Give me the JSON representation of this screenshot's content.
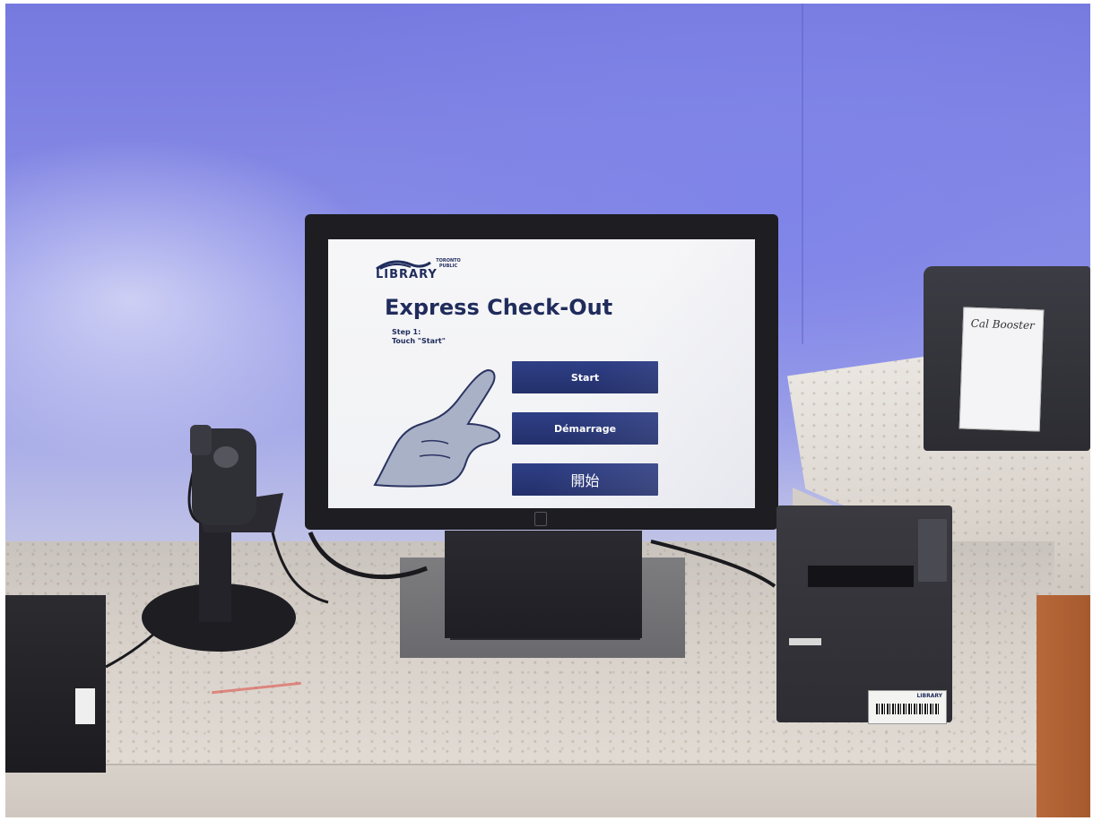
{
  "kiosk": {
    "logo": {
      "small_text_1": "TORONTO",
      "small_text_2": "PUBLIC",
      "main_text": "LIBRARY"
    },
    "title": "Express Check-Out",
    "step_line_1": "Step 1:",
    "step_line_2": "Touch \"Start\"",
    "buttons": {
      "start": "Start",
      "demarrage": "Démarrage",
      "kanji": "開始"
    }
  },
  "note_text": "Cal Booster",
  "printer_label_brand": "LIBRARY",
  "colors": {
    "kiosk_navy": "#23306b",
    "screen_background": "#f3f3f6",
    "wall_blue": "#7f84e8"
  }
}
